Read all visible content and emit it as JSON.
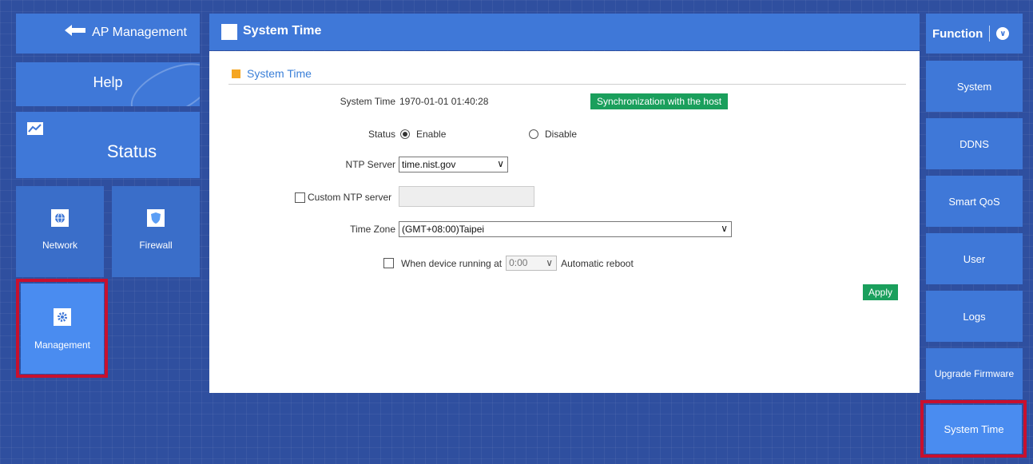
{
  "left_nav": {
    "back_label": "AP Management",
    "help_label": "Help",
    "status_label": "Status",
    "network_label": "Network",
    "firewall_label": "Firewall",
    "management_label": "Management"
  },
  "header": {
    "title": "System Time"
  },
  "panel": {
    "section_title": "System Time",
    "system_time_label": "System Time",
    "system_time_value": "1970-01-01 01:40:28",
    "sync_button": "Synchronization with the host",
    "status_label": "Status",
    "status_enable": "Enable",
    "status_disable": "Disable",
    "ntp_server_label": "NTP Server",
    "ntp_server_value": "time.nist.gov",
    "custom_ntp_label": "Custom NTP server",
    "timezone_label": "Time Zone",
    "timezone_value": "(GMT+08:00)Taipei",
    "reboot_prefix": "When device running at",
    "reboot_time": "0:00",
    "reboot_suffix": "Automatic reboot",
    "apply_button": "Apply"
  },
  "right_nav": {
    "function_label": "Function",
    "items": [
      "System",
      "DDNS",
      "Smart QoS",
      "User",
      "Logs",
      "Upgrade Firmware",
      "System Time"
    ]
  },
  "colors": {
    "tile": "#3f78d8",
    "active_tile": "#4a8cf0",
    "highlight_border": "#c8102e",
    "green_button": "#1a9f5c",
    "section_accent": "#f5a623"
  }
}
